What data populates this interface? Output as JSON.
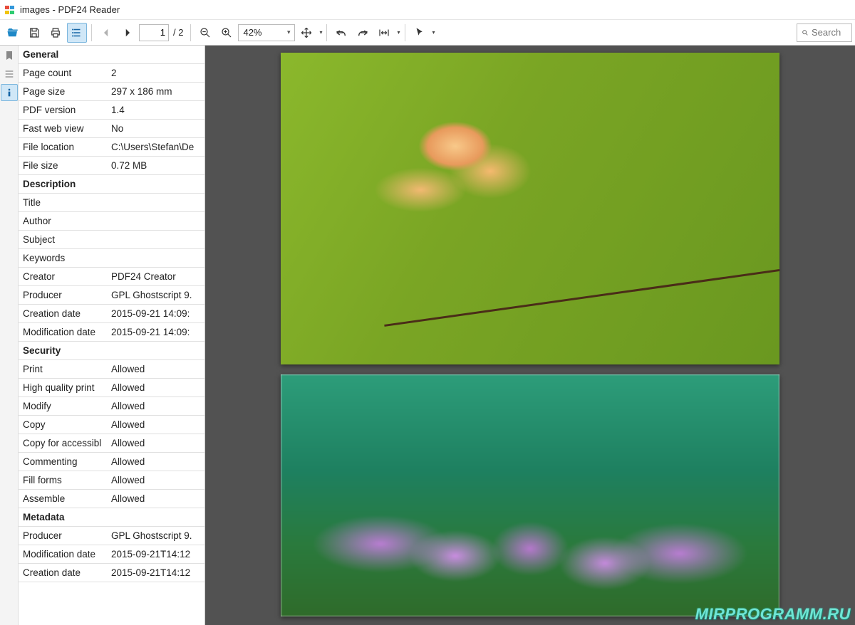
{
  "window": {
    "title": "images - PDF24 Reader"
  },
  "toolbar": {
    "page_input": "1",
    "page_total": "/  2",
    "zoom": "42%",
    "search_placeholder": "Search"
  },
  "sections": [
    {
      "title": "General",
      "rows": [
        {
          "k": "Page count",
          "v": "2"
        },
        {
          "k": "Page size",
          "v": "297 x 186 mm"
        },
        {
          "k": "PDF version",
          "v": "1.4"
        },
        {
          "k": "Fast web view",
          "v": "No"
        },
        {
          "k": "File location",
          "v": "C:\\Users\\Stefan\\De"
        },
        {
          "k": "File size",
          "v": "0.72 MB"
        }
      ]
    },
    {
      "title": "Description",
      "rows": [
        {
          "k": "Title",
          "v": ""
        },
        {
          "k": "Author",
          "v": ""
        },
        {
          "k": "Subject",
          "v": ""
        },
        {
          "k": "Keywords",
          "v": ""
        },
        {
          "k": "Creator",
          "v": "PDF24 Creator"
        },
        {
          "k": "Producer",
          "v": "GPL Ghostscript 9."
        },
        {
          "k": "Creation date",
          "v": "2015-09-21 14:09:"
        },
        {
          "k": "Modification date",
          "v": "2015-09-21 14:09:"
        }
      ]
    },
    {
      "title": "Security",
      "rows": [
        {
          "k": "Print",
          "v": "Allowed"
        },
        {
          "k": "High quality print",
          "v": "Allowed"
        },
        {
          "k": "Modify",
          "v": "Allowed"
        },
        {
          "k": "Copy",
          "v": "Allowed"
        },
        {
          "k": "Copy for accessibl",
          "v": "Allowed"
        },
        {
          "k": "Commenting",
          "v": "Allowed"
        },
        {
          "k": "Fill forms",
          "v": "Allowed"
        },
        {
          "k": "Assemble",
          "v": "Allowed"
        }
      ]
    },
    {
      "title": "Metadata",
      "rows": [
        {
          "k": "Producer",
          "v": "GPL Ghostscript 9."
        },
        {
          "k": "Modification date",
          "v": "2015-09-21T14:12"
        },
        {
          "k": "Creation date",
          "v": "2015-09-21T14:12"
        }
      ]
    }
  ],
  "watermark": "MIRPROGRAMM.RU"
}
